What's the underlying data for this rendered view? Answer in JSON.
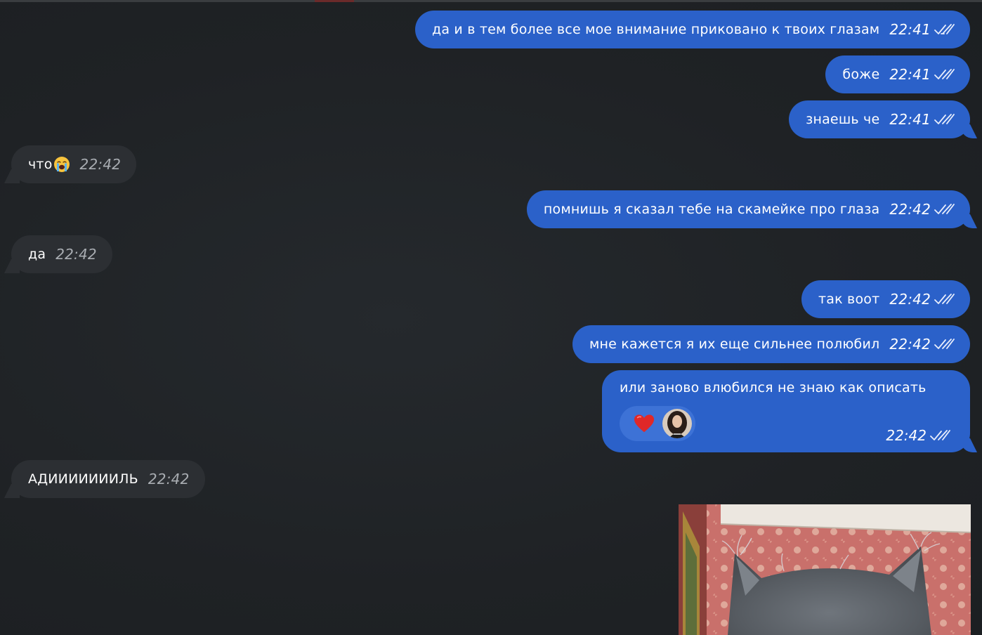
{
  "colors": {
    "background": "#1f2225",
    "outgoing_bubble": "#2b61c9",
    "incoming_bubble": "#2c2f33",
    "incoming_time": "#a9adb2"
  },
  "messages": [
    {
      "direction": "out",
      "text": "да и в тем более все мое внимание приковано к твоих глазам",
      "time": "22:41",
      "status_icon": "double-check-icon"
    },
    {
      "direction": "out",
      "text": "боже",
      "time": "22:41",
      "status_icon": "double-check-icon"
    },
    {
      "direction": "out",
      "text": "знаешь че",
      "time": "22:41",
      "status_icon": "double-check-icon"
    },
    {
      "direction": "in",
      "text": "что",
      "emoji": "crying-face-emoji",
      "time": "22:42"
    },
    {
      "direction": "out",
      "text": "помнишь я сказал тебе на скамейке про глаза",
      "time": "22:42",
      "status_icon": "double-check-icon"
    },
    {
      "direction": "in",
      "text": "да",
      "time": "22:42"
    },
    {
      "direction": "out",
      "text": "так воот",
      "time": "22:42",
      "status_icon": "double-check-icon"
    },
    {
      "direction": "out",
      "text": "мне кажется я их еще сильнее полюбил",
      "time": "22:42",
      "status_icon": "double-check-icon"
    },
    {
      "direction": "out",
      "text": "или заново влюбился не знаю как описать",
      "time": "22:42",
      "status_icon": "double-check-icon",
      "reaction": {
        "icon": "heart-icon",
        "avatar": "user-avatar"
      }
    },
    {
      "direction": "in",
      "text": "АДИИИИИИИЛЬ",
      "time": "22:42"
    },
    {
      "direction": "out",
      "type": "photo",
      "subject": "cat-photo"
    }
  ]
}
